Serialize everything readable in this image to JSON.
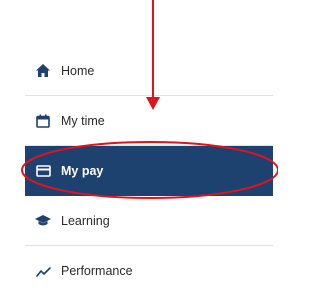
{
  "nav": {
    "items": [
      {
        "label": "Home",
        "icon": "home-icon"
      },
      {
        "label": "My time",
        "icon": "calendar-icon"
      },
      {
        "label": "My pay",
        "icon": "card-icon",
        "active": true
      },
      {
        "label": "Learning",
        "icon": "graduation-cap-icon"
      },
      {
        "label": "Performance",
        "icon": "trend-line-icon"
      }
    ]
  },
  "colors": {
    "accent": "#1d4270",
    "annotation": "#e0141b",
    "icon": "#1d4270"
  }
}
